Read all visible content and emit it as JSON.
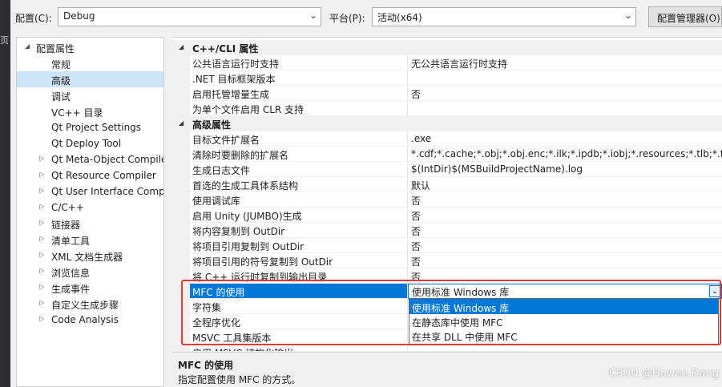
{
  "edge_text": "页",
  "toolbar": {
    "config_label": "配置(C):",
    "config_value": "Debug",
    "platform_label": "平台(P):",
    "platform_value": "活动(x64)",
    "config_manager_label": "配置管理器(O)..."
  },
  "tree": {
    "root": "配置属性",
    "items": [
      {
        "label": "常规",
        "expandable": false
      },
      {
        "label": "高级",
        "expandable": false,
        "selected": true
      },
      {
        "label": "调试",
        "expandable": false
      },
      {
        "label": "VC++ 目录",
        "expandable": false
      },
      {
        "label": "Qt Project Settings",
        "expandable": false
      },
      {
        "label": "Qt Deploy Tool",
        "expandable": false
      },
      {
        "label": "Qt Meta-Object Compile",
        "expandable": true
      },
      {
        "label": "Qt Resource Compiler",
        "expandable": true
      },
      {
        "label": "Qt User Interface Comp",
        "expandable": true
      },
      {
        "label": "C/C++",
        "expandable": true
      },
      {
        "label": "链接器",
        "expandable": true
      },
      {
        "label": "清单工具",
        "expandable": true
      },
      {
        "label": "XML 文档生成器",
        "expandable": true
      },
      {
        "label": "浏览信息",
        "expandable": true
      },
      {
        "label": "生成事件",
        "expandable": true
      },
      {
        "label": "自定义生成步骤",
        "expandable": true
      },
      {
        "label": "Code Analysis",
        "expandable": true
      }
    ]
  },
  "grid": {
    "cat1": "C++/CLI 属性",
    "rows1": [
      {
        "name": "公共语言运行时支持",
        "value": "无公共语言运行时支持"
      },
      {
        "name": ".NET 目标框架版本",
        "value": ""
      },
      {
        "name": "启用托管增量生成",
        "value": "否"
      },
      {
        "name": "为单个文件启用 CLR 支持",
        "value": ""
      }
    ],
    "cat2": "高级属性",
    "rows2": [
      {
        "name": "目标文件扩展名",
        "value": ".exe"
      },
      {
        "name": "清除时要删除的扩展名",
        "value": "*.cdf;*.cache;*.obj;*.obj.enc;*.ilk;*.ipdb;*.iobj;*.resources;*.tlb;*.tli;*.tlh"
      },
      {
        "name": "生成日志文件",
        "value": "$(IntDir)$(MSBuildProjectName).log"
      },
      {
        "name": "首选的生成工具体系结构",
        "value": "默认"
      },
      {
        "name": "使用调试库",
        "value": "否"
      },
      {
        "name": "启用 Unity (JUMBO)生成",
        "value": "否"
      },
      {
        "name": "将内容复制到 OutDir",
        "value": "否"
      },
      {
        "name": "将项目引用复制到 OutDir",
        "value": "否"
      },
      {
        "name": "将项目引用的符号复制到 OutDir",
        "value": "否"
      },
      {
        "name": "将 C++ 运行时复制到输出目录",
        "value": "否"
      },
      {
        "name": "MFC 的使用",
        "value": "使用标准 Windows 库",
        "selected": true
      },
      {
        "name": "字符集",
        "value": ""
      },
      {
        "name": "全程序优化",
        "value": ""
      },
      {
        "name": "MSVC 工具集版本",
        "value": ""
      },
      {
        "name": "启用 MSVC 结构化输出",
        "value": ""
      }
    ]
  },
  "dropdown": {
    "options": [
      "使用标准 Windows 库",
      "在静态库中使用 MFC",
      "在共享 DLL 中使用 MFC"
    ],
    "highlighted": 0
  },
  "description": {
    "title": "MFC 的使用",
    "text": "指定配置使用 MFC 的方式。"
  },
  "watermark": "CSDN @Howee.Dang",
  "colors": {
    "selection": "#0078d7",
    "annotation": "#e53935",
    "tree_selection": "#cce4f7"
  }
}
